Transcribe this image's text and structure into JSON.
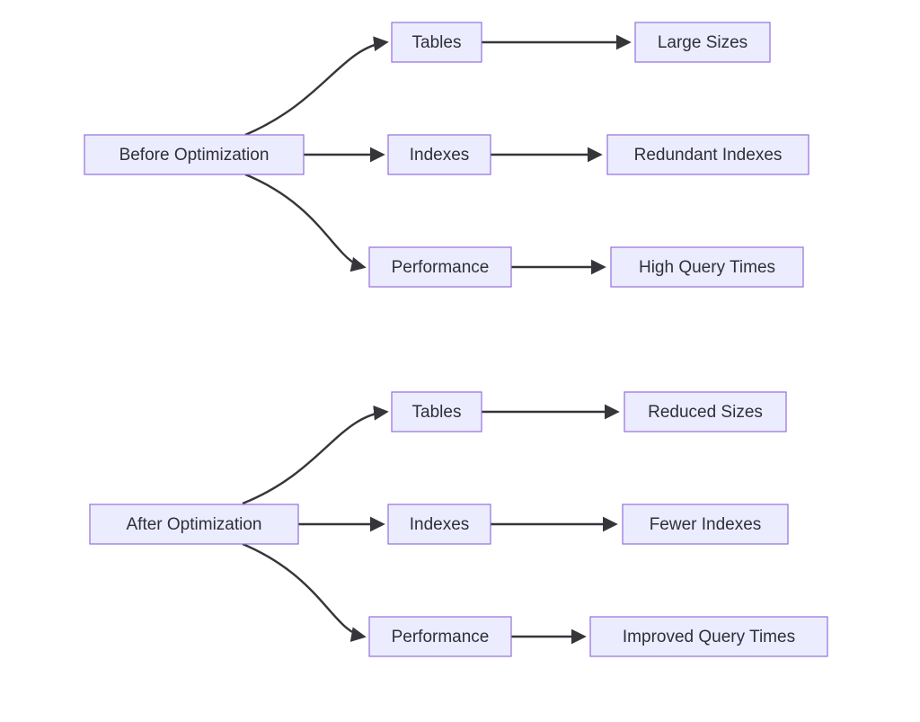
{
  "diagram": {
    "type": "flowchart",
    "direction": "LR",
    "nodes": {
      "before": {
        "label": "Before Optimization"
      },
      "b_tables": {
        "label": "Tables"
      },
      "b_indexes": {
        "label": "Indexes"
      },
      "b_performance": {
        "label": "Performance"
      },
      "b_tables_out": {
        "label": "Large Sizes"
      },
      "b_indexes_out": {
        "label": "Redundant Indexes"
      },
      "b_performance_out": {
        "label": "High Query Times"
      },
      "after": {
        "label": "After Optimization"
      },
      "a_tables": {
        "label": "Tables"
      },
      "a_indexes": {
        "label": "Indexes"
      },
      "a_performance": {
        "label": "Performance"
      },
      "a_tables_out": {
        "label": "Reduced Sizes"
      },
      "a_indexes_out": {
        "label": "Fewer Indexes"
      },
      "a_performance_out": {
        "label": "Improved Query Times"
      }
    },
    "edges": [
      [
        "before",
        "b_tables"
      ],
      [
        "before",
        "b_indexes"
      ],
      [
        "before",
        "b_performance"
      ],
      [
        "b_tables",
        "b_tables_out"
      ],
      [
        "b_indexes",
        "b_indexes_out"
      ],
      [
        "b_performance",
        "b_performance_out"
      ],
      [
        "after",
        "a_tables"
      ],
      [
        "after",
        "a_indexes"
      ],
      [
        "after",
        "a_performance"
      ],
      [
        "a_tables",
        "a_tables_out"
      ],
      [
        "a_indexes",
        "a_indexes_out"
      ],
      [
        "a_performance",
        "a_performance_out"
      ]
    ]
  }
}
